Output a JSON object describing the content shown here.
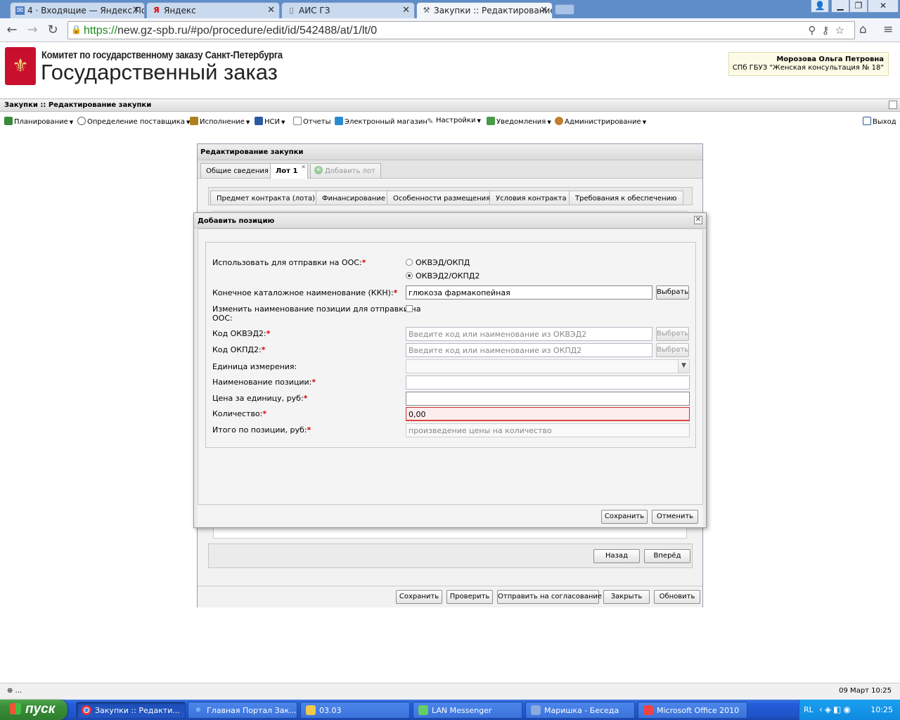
{
  "browser": {
    "tabs": [
      {
        "title": "4 · Входящие — Яндекс.По",
        "icon": "mail-icon"
      },
      {
        "title": "Яндекс",
        "icon": "yandex-icon"
      },
      {
        "title": "АИС ГЗ",
        "icon": "page-icon"
      },
      {
        "title": "Закупки :: Редактирование",
        "icon": "hammer-icon"
      }
    ],
    "url_protocol": "https://",
    "url_rest": "new.gz-spb.ru/#po/procedure/edit/id/542488/at/1/lt/0"
  },
  "site": {
    "org_name": "Комитет по государственному заказу Санкт-Петербурга",
    "title": "Государственный заказ",
    "user_name": "Морозова Ольга Петровна",
    "user_org": "СПб ГБУЗ \"Женская консультация № 18\""
  },
  "app": {
    "title": "Закупки :: Редактирование закупки"
  },
  "menu": {
    "items": [
      {
        "label": "Планирование",
        "icon_color": "#3a8a3a"
      },
      {
        "label": "Определение поставщика",
        "icon_color": "#666666"
      },
      {
        "label": "Исполнение",
        "icon_color": "#b08020"
      },
      {
        "label": "НСИ",
        "icon_color": "#2a5aa0"
      },
      {
        "label": "Отчеты",
        "icon_color": "#888888"
      },
      {
        "label": "Электронный магазин",
        "icon_color": "#2a8ad0"
      },
      {
        "label": "Настройки",
        "icon_color": "#555555"
      },
      {
        "label": "Уведомления",
        "icon_color": "#4a9a4a"
      },
      {
        "label": "Администрирование",
        "icon_color": "#c08030"
      }
    ],
    "exit_label": "Выход"
  },
  "edit_window": {
    "title": "Редактирование закупки",
    "tabs": [
      {
        "label": "Общие сведения"
      },
      {
        "label": "Лот 1"
      },
      {
        "label": "Добавить лот"
      }
    ],
    "subtabs": [
      {
        "label": "Предмет контракта (лота)"
      },
      {
        "label": "Финансирование"
      },
      {
        "label": "Особенности размещения"
      },
      {
        "label": "Условия контракта"
      },
      {
        "label": "Требования к обеспечению"
      }
    ],
    "back_label": "Назад",
    "forward_label": "Вперёд",
    "footer_buttons": [
      "Сохранить",
      "Проверить",
      "Отправить на согласование",
      "Закрыть",
      "Обновить"
    ]
  },
  "modal": {
    "title": "Добавить позицию",
    "fields": {
      "use_oos_label": "Использовать для отправки на ООС:",
      "radio_1": "ОКВЭД/ОКПД",
      "radio_2": "ОКВЭД2/ОКПД2",
      "kkn_label": "Конечное каталожное наименование (ККН):",
      "kkn_value": "глюкоза фармакопейная",
      "change_name_label_1": "Изменить наименование позиции для отправки на",
      "change_name_label_2": "ООС:",
      "okved2_label": "Код ОКВЭД2:",
      "okved2_placeholder": "Введите код или наименование из ОКВЭД2",
      "okpd2_label": "Код ОКПД2:",
      "okpd2_placeholder": "Введите код или наименование из ОКПД2",
      "unit_label": "Единица измерения:",
      "position_name_label": "Наименование позиции:",
      "price_label": "Цена за единицу, руб:",
      "qty_label": "Количество:",
      "qty_value": "0,00",
      "total_label": "Итого по позиции, руб:",
      "total_placeholder": "произведение цены на количество",
      "select_label": "Выбрать"
    },
    "save_label": "Сохранить",
    "cancel_label": "Отменить"
  },
  "statusbar": {
    "left": "⊕ ...",
    "right": "09 Март 10:25"
  },
  "taskbar": {
    "start_label": "пуск",
    "tasks": [
      {
        "label": "Закупки :: Редакти...",
        "icon": "chrome-icon"
      },
      {
        "label": "Главная Портал Зак...",
        "icon": "ie-icon"
      },
      {
        "label": "03.03",
        "icon": "folder-icon"
      },
      {
        "label": "LAN Messenger",
        "icon": "lan-icon"
      },
      {
        "label": "Маришка - Беседа",
        "icon": "chat-icon"
      },
      {
        "label": "Microsoft Office 2010",
        "icon": "office-icon"
      }
    ],
    "lang": "RL",
    "clock": "10:25"
  }
}
